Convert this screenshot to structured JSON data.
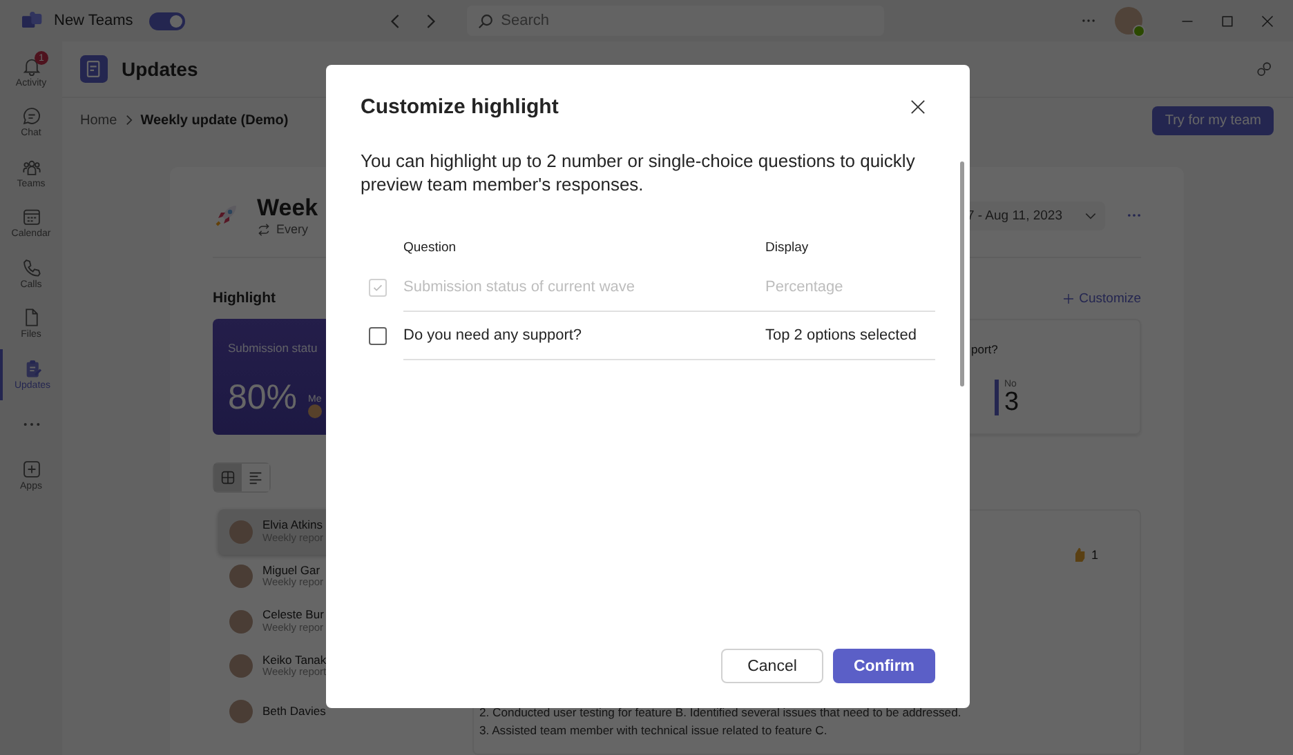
{
  "title_bar": {
    "app_label": "New Teams",
    "toggle_on": true,
    "search_placeholder": "Search"
  },
  "rail": [
    {
      "kind": "bell",
      "label": "Activity",
      "badge": "1",
      "selected": false
    },
    {
      "kind": "chat",
      "label": "Chat",
      "selected": false
    },
    {
      "kind": "people",
      "label": "Teams",
      "selected": false
    },
    {
      "kind": "calendar",
      "label": "Calendar",
      "selected": false
    },
    {
      "kind": "phone",
      "label": "Calls",
      "selected": false
    },
    {
      "kind": "file",
      "label": "Files",
      "selected": false
    },
    {
      "kind": "clipboard",
      "label": "Updates",
      "selected": true
    },
    {
      "kind": "more",
      "selected": false
    },
    {
      "kind": "plus",
      "label": "Apps",
      "selected": false
    }
  ],
  "header": {
    "title": "Updates",
    "action": "Try for my team"
  },
  "breadcrumb": [
    "Home",
    "Weekly update (Demo)"
  ],
  "report": {
    "title": "Week",
    "recurrence": "Every",
    "date_range": "7 - Aug 11, 2023",
    "highlight_heading": "Highlight",
    "customize": "Customize",
    "highlights": [
      {
        "kind": "percent",
        "label": "Submission statu",
        "value": "80%",
        "side_label": "Me"
      },
      {
        "kind": "choice",
        "label": "port?",
        "option": "No",
        "value": "3"
      }
    ],
    "view_modes": [
      {
        "kind": "grid",
        "selected": true
      },
      {
        "kind": "list",
        "selected": false
      }
    ],
    "members": [
      {
        "name": "Elvia Atkins",
        "subtitle": "Weekly repor",
        "selected": true
      },
      {
        "name": "Miguel Gar",
        "subtitle": "Weekly repor",
        "selected": false
      },
      {
        "name": "Celeste Bur",
        "subtitle": "Weekly repor",
        "selected": false
      },
      {
        "name": "Keiko Tanak",
        "subtitle": "Weekly report",
        "selected": false
      },
      {
        "name": "Beth Davies",
        "selected": false
      }
    ],
    "reaction_count": "1",
    "lines": [
      "2. Conducted user testing for feature B. Identified several issues that need to be addressed.",
      "3. Assisted team member with technical issue related to feature C."
    ]
  },
  "dialog": {
    "title": "Customize highlight",
    "description": "You can highlight up to 2 number or single-choice questions to quickly preview team member's responses.",
    "columns": [
      "Question",
      "Display"
    ],
    "questions": [
      {
        "question": "Submission status of current wave",
        "display": "Percentage",
        "checked": true,
        "disabled": true
      },
      {
        "question": "Do you need any support?",
        "display": "Top 2 options selected",
        "checked": false,
        "disabled": false
      }
    ],
    "cancel": "Cancel",
    "confirm": "Confirm"
  }
}
